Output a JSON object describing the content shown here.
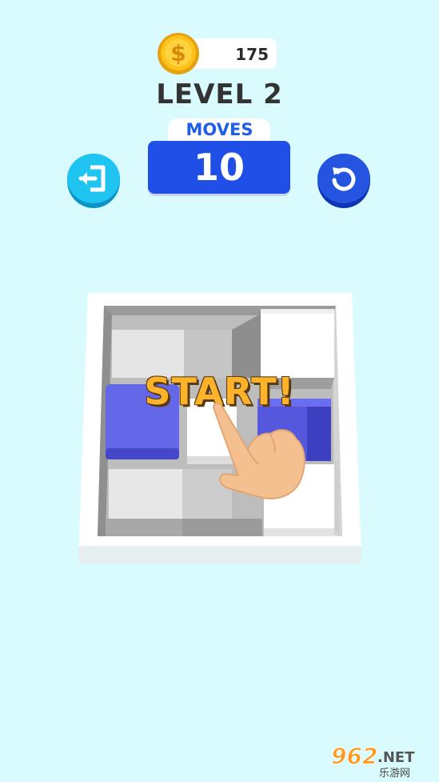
{
  "hud": {
    "coins": "175",
    "level": "LEVEL 2",
    "moves_label": "MOVES",
    "moves_value": "10"
  },
  "buttons": {
    "exit_icon": "exit-door-icon",
    "restart_icon": "restart-arrow-icon"
  },
  "board": {
    "rows": 3,
    "cols": 3,
    "blue_blocks": 2,
    "white_blocks": 4
  },
  "overlay": {
    "start_text": "START!",
    "hint_icon": "pointing-hand-icon"
  },
  "watermark": {
    "brand": "962.NET",
    "sub": "乐游网"
  },
  "colors": {
    "background": "#d9fbfd",
    "blue": "#1f4fe6",
    "block_blue": "#6468e8",
    "start_text": "#ffb32a",
    "coin": "#ffc21a"
  }
}
